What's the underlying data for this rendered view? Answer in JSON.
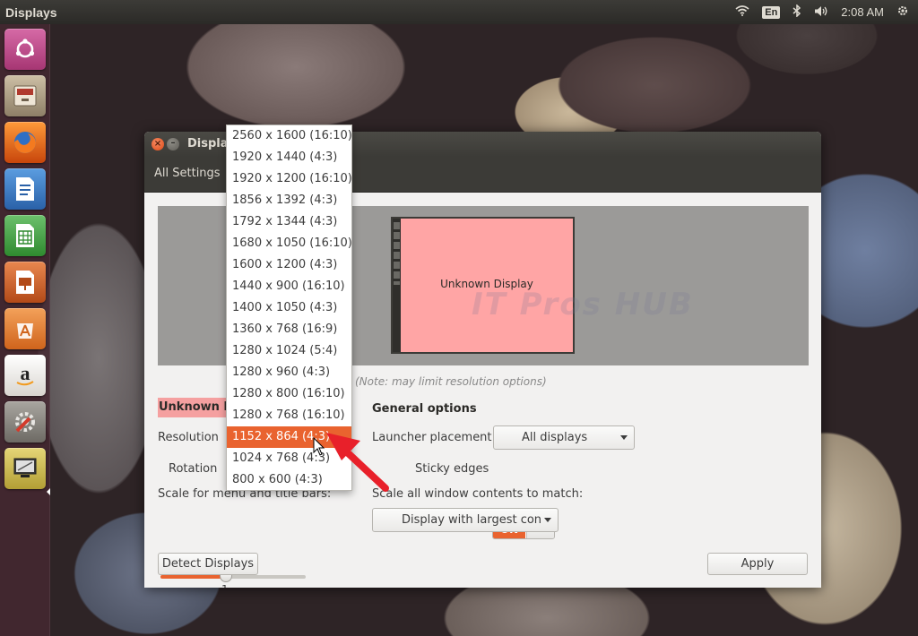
{
  "top_panel": {
    "app_title": "Displays",
    "keyboard_layout": "En",
    "clock": "2:08 AM"
  },
  "launcher": {
    "items": [
      {
        "name": "ubuntu-dash",
        "icon": "ubuntu-logo-icon",
        "color": "#c34a90"
      },
      {
        "name": "files",
        "icon": "file-cabinet-icon",
        "color": "#a9997f"
      },
      {
        "name": "firefox",
        "icon": "firefox-icon",
        "color": "#e66000"
      },
      {
        "name": "writer",
        "icon": "libreoffice-writer-icon",
        "color": "#2a6fb7"
      },
      {
        "name": "calc",
        "icon": "libreoffice-calc-icon",
        "color": "#3c9b3c"
      },
      {
        "name": "impress",
        "icon": "libreoffice-impress-icon",
        "color": "#c3501f"
      },
      {
        "name": "software-center",
        "icon": "software-center-icon",
        "color": "#e07a2e"
      },
      {
        "name": "amazon",
        "icon": "amazon-icon",
        "color": "#e8e6e2"
      },
      {
        "name": "system-settings",
        "icon": "settings-wrench-icon",
        "color": "#8a8782"
      },
      {
        "name": "displays",
        "icon": "display-settings-icon",
        "color": "#c9b64a"
      }
    ]
  },
  "window": {
    "title": "Displays",
    "toolbar": {
      "all_settings_label": "All Settings"
    },
    "preview": {
      "monitor_label": "Unknown Display",
      "watermark": "IT Pros HUB"
    },
    "note": "(Note: may limit resolution options)",
    "display_section": {
      "heading": "Unknown Display",
      "resolution_label": "Resolution",
      "rotation_label": "Rotation",
      "scale_label": "Scale for menu and title bars:",
      "scale_value": "1",
      "scale_fraction": 0.45
    },
    "general_options": {
      "heading": "General options",
      "launcher_placement_label": "Launcher placement",
      "launcher_placement_value": "All displays",
      "sticky_edges_label": "Sticky edges",
      "sticky_edges_state": "ON",
      "scale_all_label": "Scale all window contents to match:",
      "scale_all_value": "Display with largest contr"
    },
    "buttons": {
      "detect_displays": "Detect Displays",
      "apply": "Apply"
    }
  },
  "resolution_menu": {
    "selected_index": 14,
    "items": [
      "2560 x 1600 (16:10)",
      "1920 x 1440 (4:3)",
      "1920 x 1200 (16:10)",
      "1856 x 1392 (4:3)",
      "1792 x 1344 (4:3)",
      "1680 x 1050 (16:10)",
      "1600 x 1200 (4:3)",
      "1440 x 900 (16:10)",
      "1400 x 1050 (4:3)",
      "1360 x 768 (16:9)",
      "1280 x 1024 (5:4)",
      "1280 x 960 (4:3)",
      "1280 x 800 (16:10)",
      "1280 x 768 (16:10)",
      "1152 x 864 (4:3)",
      "1024 x 768 (4:3)",
      "800 x 600 (4:3)"
    ]
  },
  "colors": {
    "accent": "#e9632f",
    "annotation_arrow": "#e8202a",
    "monitor_fill": "#ffa5a5"
  }
}
